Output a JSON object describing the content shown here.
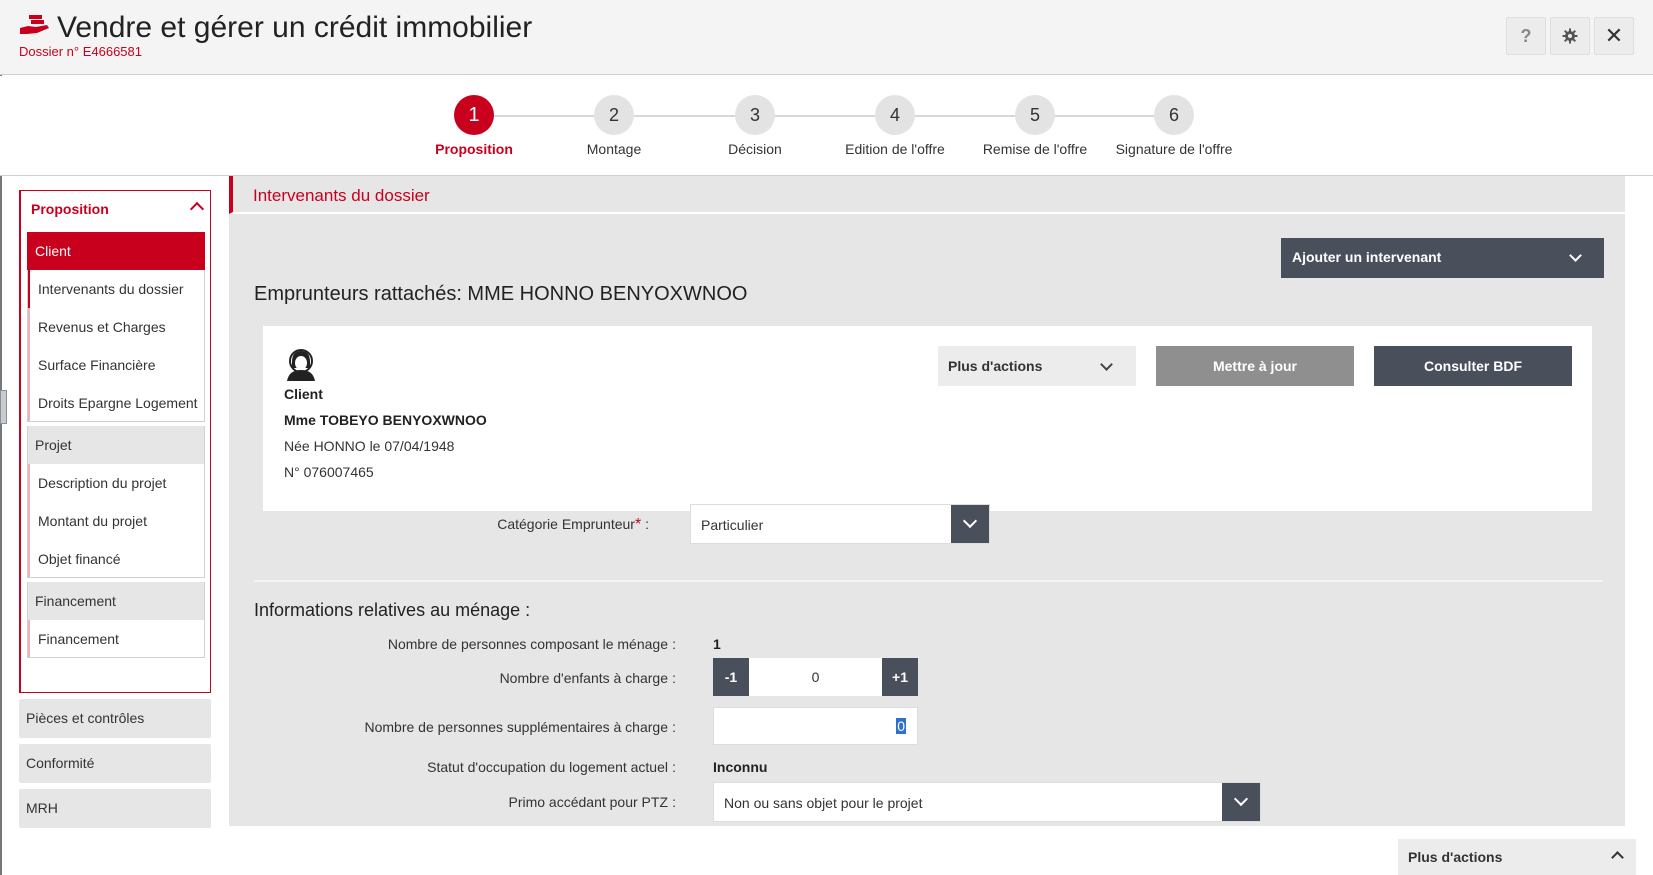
{
  "header": {
    "title": "Vendre et gérer un crédit immobilier",
    "dossier": "Dossier n° E4666581",
    "help_label": "?",
    "close_label": "✕"
  },
  "stepper": {
    "steps": [
      {
        "number": "1",
        "label": "Proposition",
        "active": true
      },
      {
        "number": "2",
        "label": "Montage"
      },
      {
        "number": "3",
        "label": "Décision"
      },
      {
        "number": "4",
        "label": "Edition de l'offre"
      },
      {
        "number": "5",
        "label": "Remise de l'offre"
      },
      {
        "number": "6",
        "label": "Signature de l'offre"
      }
    ]
  },
  "sidebar": {
    "group_title": "Proposition",
    "items": [
      {
        "label": "Client"
      },
      {
        "label": "Intervenants du dossier"
      },
      {
        "label": "Revenus et Charges"
      },
      {
        "label": "Surface Financière"
      },
      {
        "label": "Droits Epargne Logement"
      },
      {
        "label": "Projet"
      },
      {
        "label": "Description du projet"
      },
      {
        "label": "Montant du projet"
      },
      {
        "label": "Objet financé"
      },
      {
        "label": "Financement"
      },
      {
        "label": "Financement"
      }
    ],
    "outside": [
      {
        "label": "Pièces et contrôles"
      },
      {
        "label": "Conformité"
      },
      {
        "label": "MRH"
      }
    ]
  },
  "main": {
    "section_title": "Intervenants du dossier",
    "add_button": "Ajouter un intervenant",
    "borrowers_title": "Emprunteurs rattachés: MME HONNO BENYOXWNOO",
    "card": {
      "role": "Client",
      "name": "Mme TOBEYO BENYOXWNOO",
      "birth": "Née HONNO le 07/04/1948",
      "number": "N° 076007465",
      "more_actions": "Plus d'actions",
      "update": "Mettre à jour",
      "consult": "Consulter BDF"
    },
    "categorie": {
      "label": "Catégorie Emprunteur",
      "required": "*",
      "colon": ":",
      "value": "Particulier"
    },
    "menage": {
      "title": "Informations relatives au ménage :",
      "nb_personnes_label": "Nombre de personnes composant le ménage",
      "nb_personnes_value": "1",
      "nb_enfants_label": "Nombre d'enfants à charge",
      "nb_enfants_value": "0",
      "minus": "-1",
      "plus": "+1",
      "nb_supp_label": "Nombre de personnes supplémentaires à charge",
      "nb_supp_value": "0",
      "statut_label": "Statut d'occupation du logement actuel",
      "statut_value": "Inconnu",
      "primo_label": "Primo accédant pour PTZ",
      "primo_value": "Non ou sans objet pour le projet",
      "colon": ":"
    }
  },
  "footer": {
    "more_actions": "Plus d'actions"
  },
  "colors": {
    "brand_red": "#c8001e",
    "dark_button": "#4a4f5c",
    "panel_grey": "#e6e6e6"
  }
}
